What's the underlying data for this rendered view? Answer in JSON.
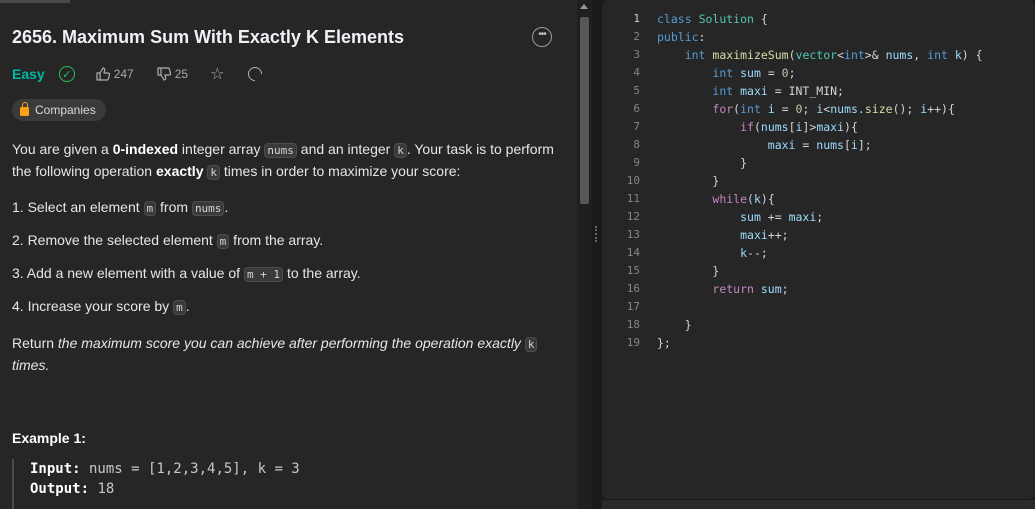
{
  "problem": {
    "title": "2656. Maximum Sum With Exactly K Elements",
    "difficulty": "Easy",
    "likes": "247",
    "dislikes": "25",
    "companies_label": "Companies",
    "description": {
      "p1_a": "You are given a ",
      "p1_b": "0-indexed",
      "p1_c": " integer array ",
      "p1_code1": "nums",
      "p1_d": " and an integer ",
      "p1_code2": "k",
      "p1_e": ". Your task is to perform the following operation ",
      "p1_f": "exactly",
      "p1_code3": "k",
      "p1_g": " times in order to maximize your score:",
      "step1_a": "1. Select an element ",
      "step1_code1": "m",
      "step1_b": " from ",
      "step1_code2": "nums",
      "step1_c": ".",
      "step2_a": "2. Remove the selected element ",
      "step2_code": "m",
      "step2_b": " from the array.",
      "step3_a": "3. Add a new element with a value of ",
      "step3_code": "m + 1",
      "step3_b": " to the array.",
      "step4_a": "4. Increase your score by ",
      "step4_code": "m",
      "step4_b": ".",
      "ret_a": "Return ",
      "ret_b": "the maximum score you can achieve after performing the operation exactly ",
      "ret_code": "k",
      "ret_c": "times."
    },
    "example1": {
      "title": "Example 1:",
      "input_label": "Input:",
      "input_value": " nums = [1,2,3,4,5], k = 3",
      "output_label": "Output:",
      "output_value": " 18"
    }
  },
  "editor": {
    "line_numbers": [
      "1",
      "2",
      "3",
      "4",
      "5",
      "6",
      "7",
      "8",
      "9",
      "10",
      "11",
      "12",
      "13",
      "14",
      "15",
      "16",
      "17",
      "18",
      "19"
    ]
  },
  "colors": {
    "accent_easy": "#00b8a3",
    "solved": "#2cbb5d",
    "lock": "#ffa116"
  },
  "icons": [
    "more-icon",
    "solved-check-icon",
    "thumbs-up-icon",
    "thumbs-down-icon",
    "star-icon",
    "share-icon",
    "lock-icon"
  ]
}
